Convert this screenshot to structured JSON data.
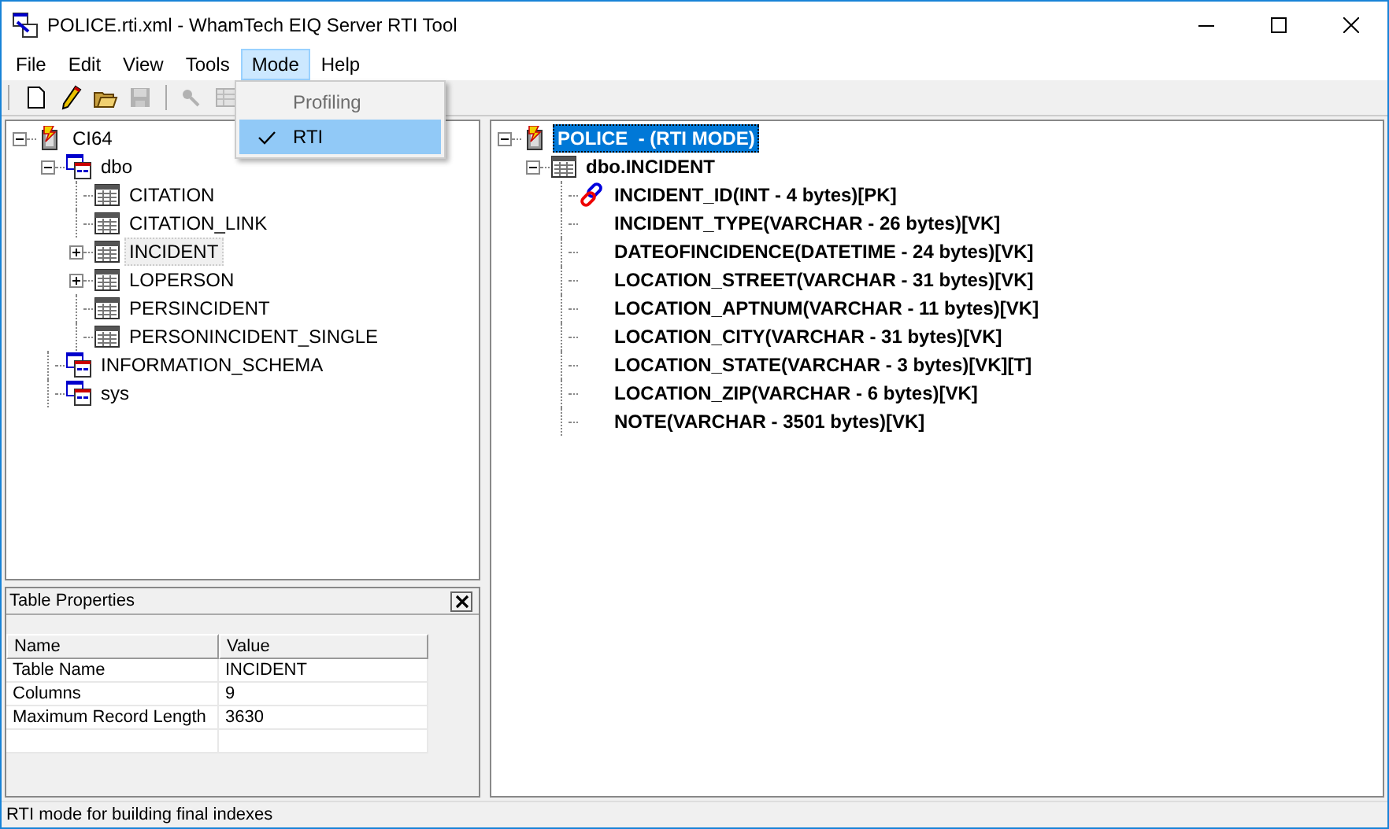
{
  "window": {
    "title": "POLICE.rti.xml - WhamTech EIQ Server RTI Tool"
  },
  "menu": [
    {
      "label": "File",
      "selected": false
    },
    {
      "label": "Edit",
      "selected": false
    },
    {
      "label": "View",
      "selected": false
    },
    {
      "label": "Tools",
      "selected": false
    },
    {
      "label": "Mode",
      "selected": true
    },
    {
      "label": "Help",
      "selected": false
    }
  ],
  "dropdown": [
    {
      "label": "Profiling",
      "disabled": true,
      "checked": false
    },
    {
      "label": "RTI",
      "disabled": false,
      "checked": true
    }
  ],
  "toolbar": [
    {
      "kind": "new",
      "disabled": false
    },
    {
      "kind": "edit",
      "disabled": false
    },
    {
      "kind": "open",
      "disabled": false
    },
    {
      "kind": "save",
      "disabled": true
    },
    {
      "kind": "sep"
    },
    {
      "kind": "key",
      "disabled": true
    },
    {
      "kind": "grid",
      "disabled": true
    }
  ],
  "left_tree": [
    {
      "label": "CI64",
      "kind": "server",
      "expanded": true,
      "selected": false,
      "children": [
        {
          "label": "dbo",
          "kind": "schema",
          "expanded": true,
          "selected": false,
          "children": [
            {
              "label": "CITATION",
              "kind": "table",
              "selected": false
            },
            {
              "label": "CITATION_LINK",
              "kind": "table",
              "selected": false
            },
            {
              "label": "INCIDENT",
              "kind": "table",
              "expanded": false,
              "selected": true
            },
            {
              "label": "LOPERSON",
              "kind": "table",
              "expanded": false,
              "selected": false
            },
            {
              "label": "PERSINCIDENT",
              "kind": "table",
              "selected": false
            },
            {
              "label": "PERSONINCIDENT_SINGLE",
              "kind": "table",
              "selected": false
            }
          ]
        },
        {
          "label": "INFORMATION_SCHEMA",
          "kind": "schema",
          "selected": false
        },
        {
          "label": "sys",
          "kind": "schema",
          "selected": false
        }
      ]
    }
  ],
  "properties": {
    "title": "Table Properties",
    "columns": [
      "Name",
      "Value"
    ],
    "rows": [
      [
        "Table Name",
        "INCIDENT"
      ],
      [
        "Columns",
        "9"
      ],
      [
        "Maximum Record Length",
        "3630"
      ]
    ]
  },
  "right_tree": [
    {
      "label": "POLICE  - (RTI MODE)",
      "kind": "server",
      "expanded": true,
      "selected": true,
      "children": [
        {
          "label": "dbo.INCIDENT",
          "kind": "table",
          "expanded": true,
          "selected": false,
          "children": [
            {
              "label": "INCIDENT_ID(INT - 4 bytes)[PK]",
              "kind": "key",
              "selected": false
            },
            {
              "label": "INCIDENT_TYPE(VARCHAR - 26 bytes)[VK]",
              "kind": "column",
              "selected": false
            },
            {
              "label": "DATEOFINCIDENCE(DATETIME - 24 bytes)[VK]",
              "kind": "column",
              "selected": false
            },
            {
              "label": "LOCATION_STREET(VARCHAR - 31 bytes)[VK]",
              "kind": "column",
              "selected": false
            },
            {
              "label": "LOCATION_APTNUM(VARCHAR - 11 bytes)[VK]",
              "kind": "column",
              "selected": false
            },
            {
              "label": "LOCATION_CITY(VARCHAR - 31 bytes)[VK]",
              "kind": "column",
              "selected": false
            },
            {
              "label": "LOCATION_STATE(VARCHAR - 3 bytes)[VK][T]",
              "kind": "column",
              "selected": false
            },
            {
              "label": "LOCATION_ZIP(VARCHAR - 6 bytes)[VK]",
              "kind": "column",
              "selected": false
            },
            {
              "label": "NOTE(VARCHAR - 3501 bytes)[VK]",
              "kind": "column",
              "selected": false
            }
          ]
        }
      ]
    }
  ],
  "status_bar": "RTI mode for building final indexes"
}
